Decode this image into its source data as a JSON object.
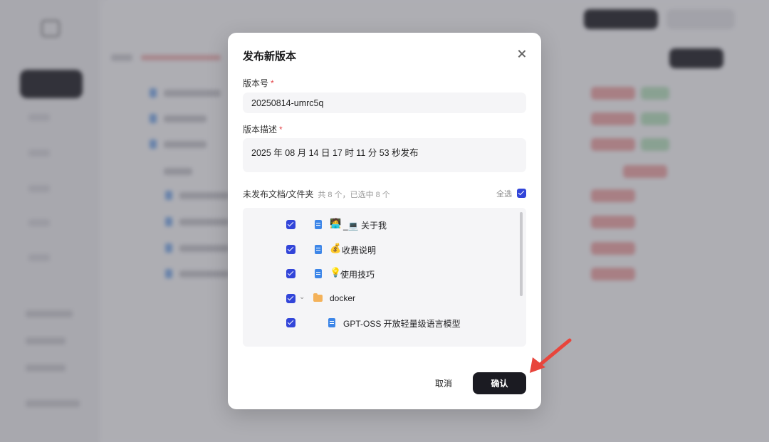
{
  "modal": {
    "title": "发布新版本",
    "version_label": "版本号",
    "required_mark": "*",
    "version_value": "20250814-umrc5q",
    "desc_label": "版本描述",
    "desc_value": "2025 年 08 月 14 日 17 时 11 分 53 秒发布",
    "list_title": "未发布文档/文件夹",
    "list_count": "共 8 个，已选中 8 个",
    "select_all_label": "全选",
    "items": [
      {
        "emoji": "🧑‍💻",
        "label": "_💻 关于我",
        "type": "doc",
        "checked": true
      },
      {
        "emoji": "💰",
        "label": "收费说明",
        "type": "doc",
        "checked": true
      },
      {
        "emoji": "💡",
        "label": "使用技巧",
        "type": "doc",
        "checked": true
      },
      {
        "emoji": "",
        "label": "docker",
        "type": "folder",
        "checked": true
      },
      {
        "emoji": "",
        "label": "GPT-OSS 开放轻量级语言模型",
        "type": "doc",
        "checked": true
      }
    ],
    "cancel_label": "取消",
    "confirm_label": "确认"
  },
  "colors": {
    "checkbox": "#3245d9",
    "confirm_button": "#1b1b22",
    "arrow": "#e8453c",
    "required": "#e5484d"
  }
}
